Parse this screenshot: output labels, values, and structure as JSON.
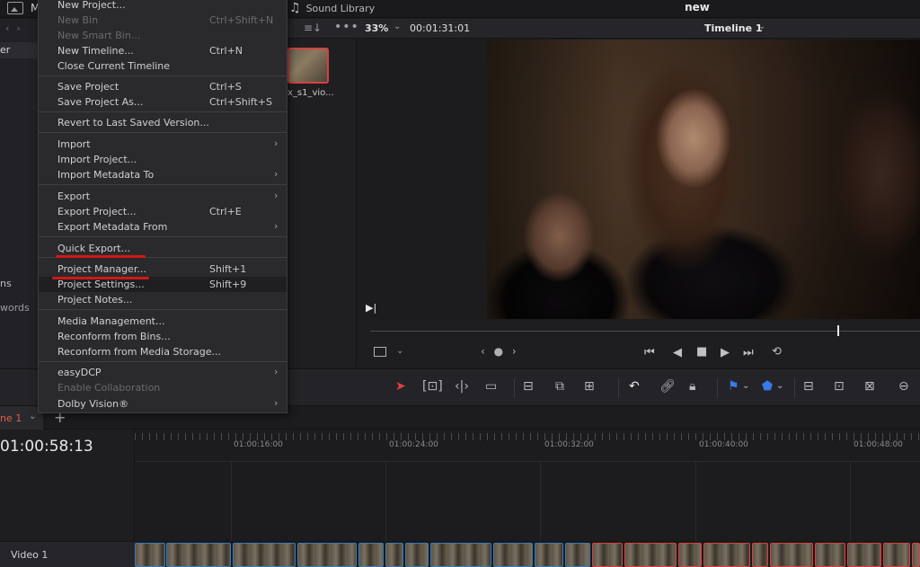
{
  "topbar": {
    "project_name": "new",
    "menu_letter": "M",
    "sound_library": "Sound Library"
  },
  "viewer_header": {
    "zoom": "33%",
    "timecode": "00:01:31:01",
    "timeline_name": "Timeline 1"
  },
  "left_panel": {
    "bin_header_fragment": "er",
    "text_fragment_1": "ns",
    "text_fragment_2": "words"
  },
  "media_pool": {
    "clip_label": "x_s1_vio..."
  },
  "file_menu": {
    "items": [
      {
        "label": "New Project...",
        "shortcut": "",
        "submenu": false,
        "disabled": false
      },
      {
        "label": "New Bin",
        "shortcut": "Ctrl+Shift+N",
        "submenu": false,
        "disabled": true
      },
      {
        "label": "New Smart Bin...",
        "shortcut": "",
        "submenu": false,
        "disabled": true
      },
      {
        "label": "New Timeline...",
        "shortcut": "Ctrl+N",
        "submenu": false,
        "disabled": false
      },
      {
        "label": "Close Current Timeline",
        "shortcut": "",
        "submenu": false,
        "disabled": false
      },
      {
        "label": "Save Project",
        "shortcut": "Ctrl+S",
        "submenu": false,
        "disabled": false
      },
      {
        "label": "Save Project As...",
        "shortcut": "Ctrl+Shift+S",
        "submenu": false,
        "disabled": false
      },
      {
        "label": "Revert to Last Saved Version...",
        "shortcut": "",
        "submenu": false,
        "disabled": false
      },
      {
        "label": "Import",
        "shortcut": "",
        "submenu": true,
        "disabled": false
      },
      {
        "label": "Import Project...",
        "shortcut": "",
        "submenu": false,
        "disabled": false
      },
      {
        "label": "Import Metadata To",
        "shortcut": "",
        "submenu": true,
        "disabled": false
      },
      {
        "label": "Export",
        "shortcut": "",
        "submenu": true,
        "disabled": false
      },
      {
        "label": "Export Project...",
        "shortcut": "Ctrl+E",
        "submenu": false,
        "disabled": false
      },
      {
        "label": "Export Metadata From",
        "shortcut": "",
        "submenu": true,
        "disabled": false
      },
      {
        "label": "Quick Export...",
        "shortcut": "",
        "submenu": false,
        "disabled": false
      },
      {
        "label": "Project Manager...",
        "shortcut": "Shift+1",
        "submenu": false,
        "disabled": false
      },
      {
        "label": "Project Settings...",
        "shortcut": "Shift+9",
        "submenu": false,
        "disabled": false
      },
      {
        "label": "Project Notes...",
        "shortcut": "",
        "submenu": false,
        "disabled": false
      },
      {
        "label": "Media Management...",
        "shortcut": "",
        "submenu": false,
        "disabled": false
      },
      {
        "label": "Reconform from Bins...",
        "shortcut": "",
        "submenu": false,
        "disabled": false
      },
      {
        "label": "Reconform from Media Storage...",
        "shortcut": "",
        "submenu": false,
        "disabled": false
      },
      {
        "label": "easyDCP",
        "shortcut": "",
        "submenu": true,
        "disabled": false
      },
      {
        "label": "Enable Collaboration",
        "shortcut": "",
        "submenu": false,
        "disabled": true
      },
      {
        "label": "Dolby Vision®",
        "shortcut": "",
        "submenu": true,
        "disabled": false
      }
    ]
  },
  "timeline": {
    "tab_label": "ne 1",
    "current_timecode": "01:00:58:13",
    "track_name": "Video 1",
    "ruler_labels": [
      "01:00:16:00",
      "01:00:24:00",
      "01:00:32:00",
      "01:00:40:00",
      "01:00:48:00"
    ]
  },
  "colors": {
    "accent_red": "#d84040",
    "clip_blue": "#3a7ab8",
    "annotation_red": "#d01818"
  }
}
